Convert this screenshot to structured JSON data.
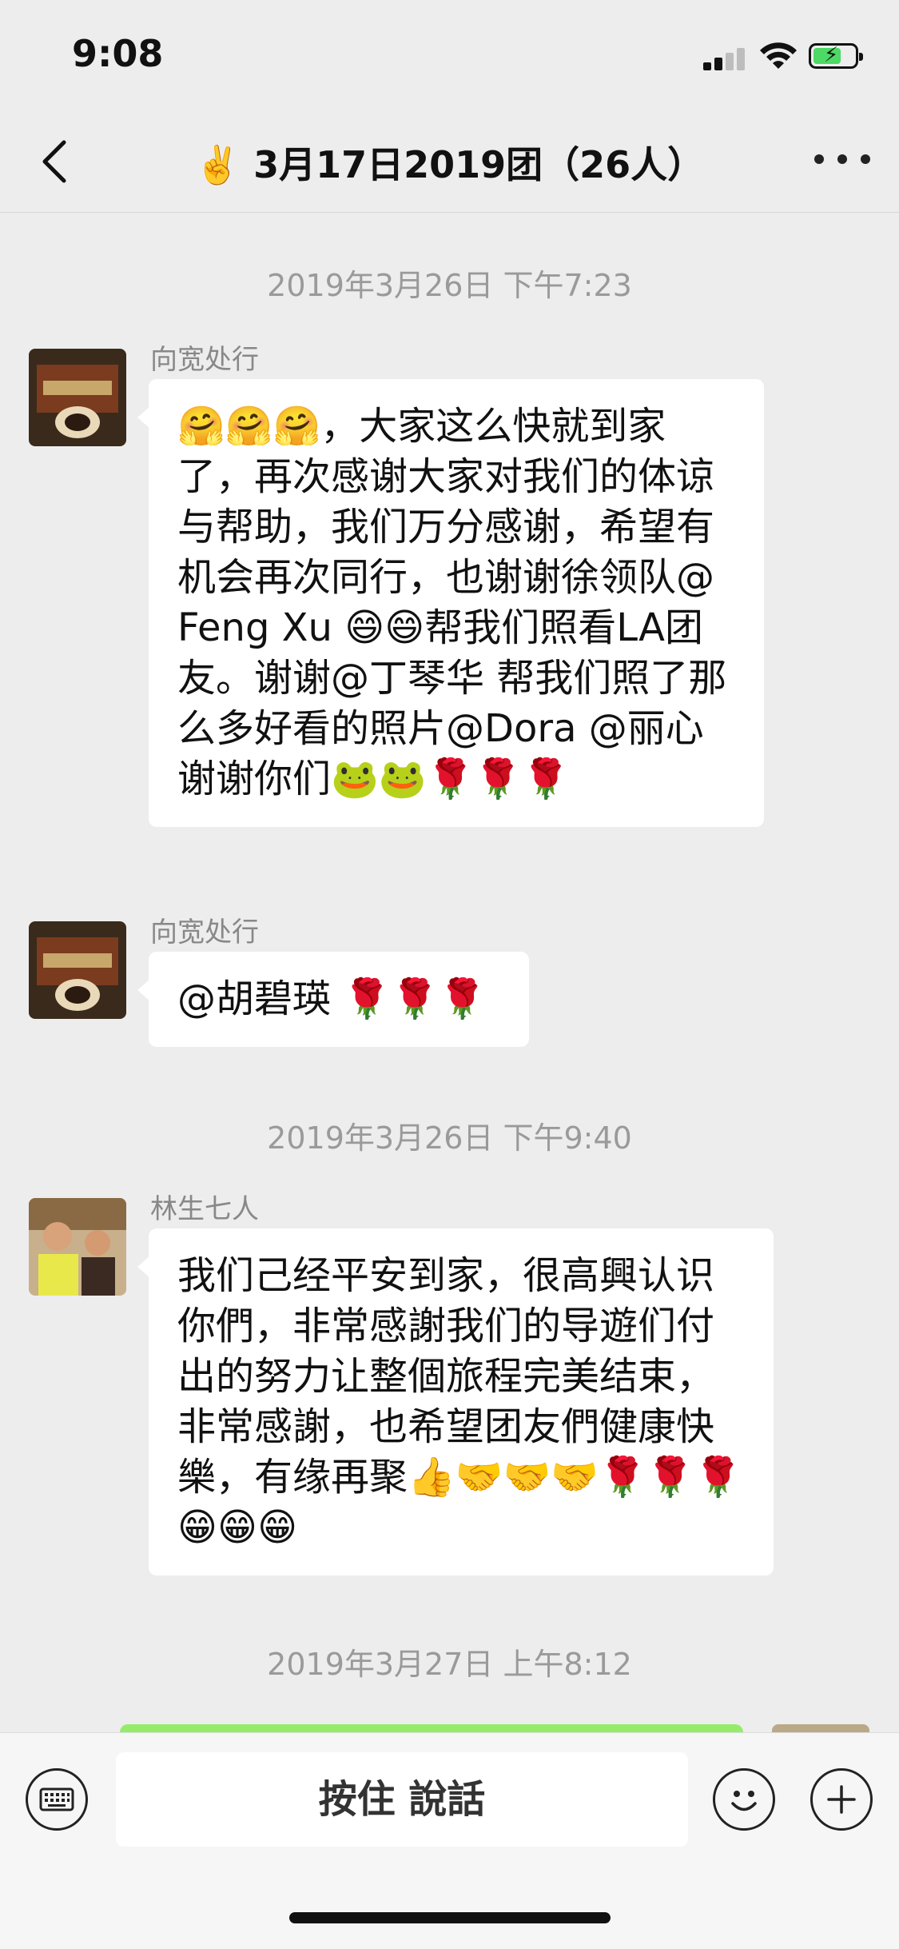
{
  "status_bar": {
    "time": "9:08",
    "battery_charging": true
  },
  "nav": {
    "title": "✌️ 3月17日2019团（26人）",
    "back_icon": "chevron-left-icon",
    "more_icon": "ellipsis-icon"
  },
  "messages": {
    "ts1": "2019年3月26日 下午7:23",
    "m1_sender": "向宽处行",
    "m1_text": "🤗🤗🤗，大家这么快就到家了，再次感谢大家对我们的体谅与帮助，我们万分感谢，希望有机会再次同行，也谢谢徐领队@Feng Xu 😄😄帮我们照看LA团友。谢谢@丁琴华 帮我们照了那么多好看的照片@Dora @丽心 谢谢你们🐸🐸🌹🌹🌹",
    "m2_sender": "向宽处行",
    "m2_text": "@胡碧瑛 🌹🌹🌹",
    "ts2": "2019年3月26日 下午9:40",
    "m3_sender": "林生七人",
    "m3_text": "我们己经平安到家，很高興认识你們，非常感謝我们的导遊们付出的努力让整個旅程完美结束，非常感謝，也希望团友們健康快樂，有缘再聚👍🤝🤝🤝🌹🌹🌹😁😁😁",
    "ts3": "2019年3月27日 上午8:12"
  },
  "input_bar": {
    "talk_label": "按住 說話",
    "keyboard_icon": "keyboard-icon",
    "emoji_icon": "emoji-icon",
    "plus_icon": "plus-icon"
  },
  "colors": {
    "background": "#ededed",
    "bubble_other": "#ffffff",
    "bubble_self": "#95ec69",
    "timestamp": "#9a9a9a"
  }
}
